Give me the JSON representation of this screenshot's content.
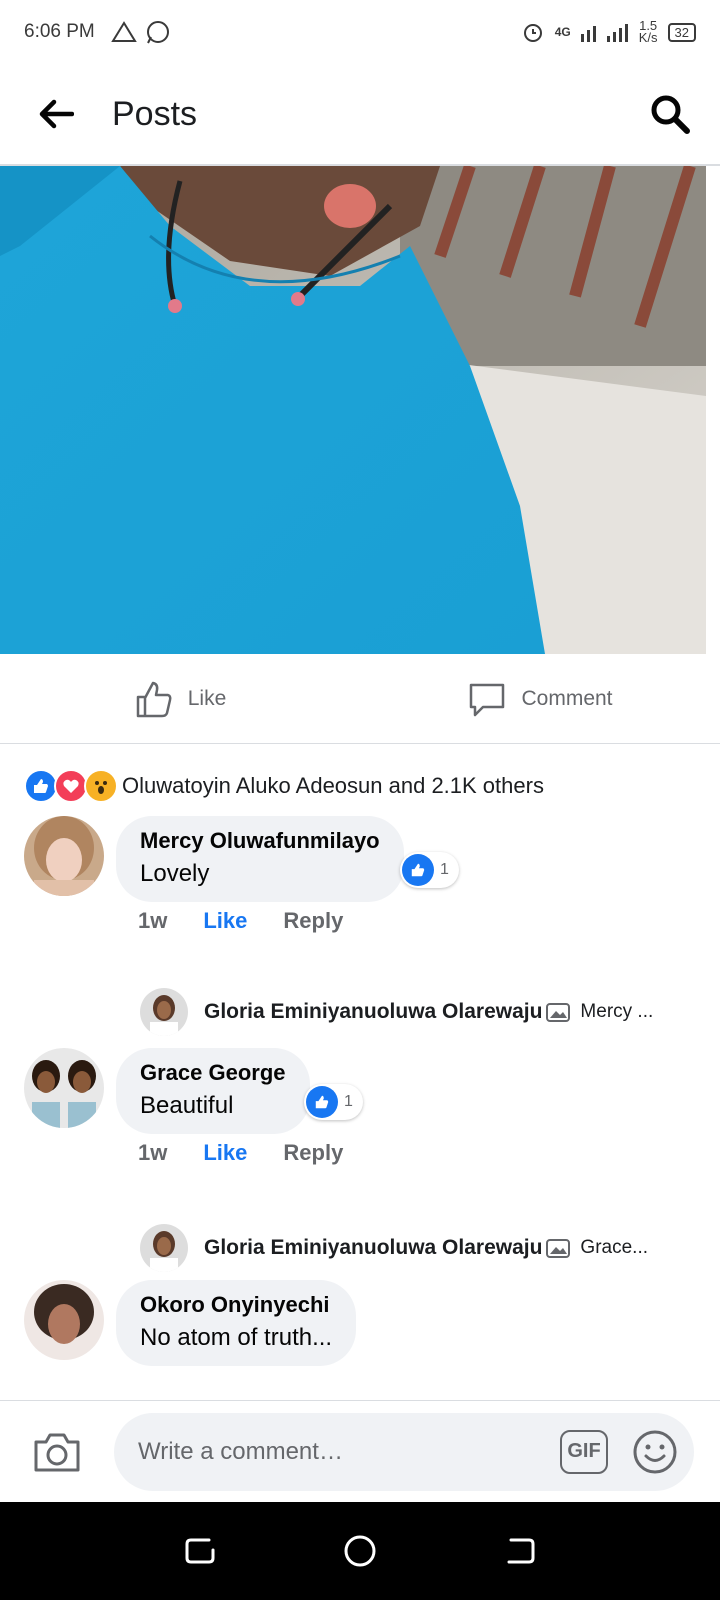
{
  "status_bar": {
    "time": "6:06 PM",
    "network": "4G",
    "speed": "1.5",
    "speed_unit": "K/s",
    "battery": "32"
  },
  "header": {
    "title": "Posts"
  },
  "actions": {
    "like_label": "Like",
    "comment_label": "Comment"
  },
  "reactions": {
    "summary": "Oluwatoyin Aluko Adeosun and 2.1K others"
  },
  "comments": [
    {
      "name": "Mercy Oluwafunmilayo",
      "text": "Lovely",
      "likes": "1",
      "time": "1w",
      "like_label": "Like",
      "reply_label": "Reply",
      "reply": {
        "name": "Gloria Eminiyanuoluwa Olarewaju",
        "preview": "Mercy ..."
      }
    },
    {
      "name": "Grace George",
      "text": "Beautiful",
      "likes": "1",
      "time": "1w",
      "like_label": "Like",
      "reply_label": "Reply",
      "reply": {
        "name": "Gloria Eminiyanuoluwa Olarewaju",
        "preview": "Grace..."
      }
    },
    {
      "name": "Okoro Onyinyechi",
      "text": "No atom of truth..."
    }
  ],
  "composer": {
    "placeholder": "Write a comment…",
    "gif_label": "GIF"
  },
  "colors": {
    "accent": "#1877f2",
    "bubble": "#f0f2f5",
    "secondary_text": "#65676b"
  }
}
